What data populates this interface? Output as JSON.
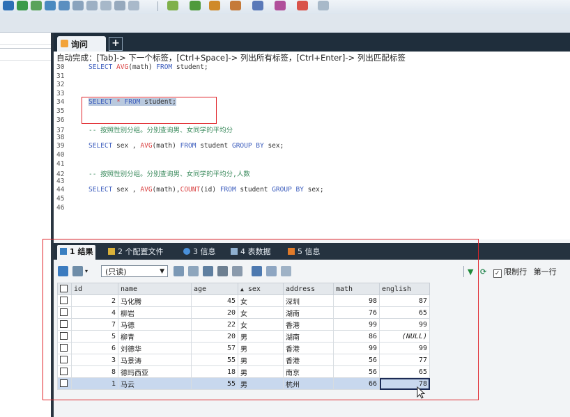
{
  "query_tab": {
    "label": "询问",
    "add": "+"
  },
  "editor": {
    "autocomplete_hint": "自动完成：[Tab]-> 下一个标签，[Ctrl+Space]-> 列出所有标签，[Ctrl+Enter]-> 列出匹配标签",
    "lines": [
      {
        "num": "30",
        "segments": [
          {
            "cls": "kw",
            "text": "SELECT "
          },
          {
            "cls": "fn",
            "text": "AVG"
          },
          {
            "cls": "",
            "text": "(math) "
          },
          {
            "cls": "kw",
            "text": "FROM"
          },
          {
            "cls": "",
            "text": " student;"
          }
        ]
      },
      {
        "num": "31",
        "segments": []
      },
      {
        "num": "32",
        "segments": []
      },
      {
        "num": "33",
        "segments": []
      },
      {
        "num": "34",
        "segments": [
          {
            "cls": "kw hl",
            "text": "SELECT"
          },
          {
            "cls": "hl",
            "text": " "
          },
          {
            "cls": "fn hl",
            "text": "*"
          },
          {
            "cls": "hl",
            "text": " "
          },
          {
            "cls": "kw hl",
            "text": "FROM"
          },
          {
            "cls": "hl",
            "text": " student;"
          }
        ]
      },
      {
        "num": "35",
        "segments": []
      },
      {
        "num": "36",
        "segments": []
      },
      {
        "num": "37",
        "segments": [
          {
            "cls": "cm",
            "text": "-- 按照性别分组。分别查询男、女同学的平均分"
          }
        ]
      },
      {
        "num": "38",
        "segments": []
      },
      {
        "num": "39",
        "segments": [
          {
            "cls": "kw",
            "text": "SELECT"
          },
          {
            "cls": "",
            "text": " sex , "
          },
          {
            "cls": "fn",
            "text": "AVG"
          },
          {
            "cls": "",
            "text": "(math) "
          },
          {
            "cls": "kw",
            "text": "FROM"
          },
          {
            "cls": "",
            "text": " student "
          },
          {
            "cls": "kw",
            "text": "GROUP BY"
          },
          {
            "cls": "",
            "text": " sex;"
          }
        ]
      },
      {
        "num": "40",
        "segments": []
      },
      {
        "num": "41",
        "segments": []
      },
      {
        "num": "42",
        "segments": [
          {
            "cls": "cm",
            "text": "-- 按照性别分组。分别查询男、女同学的平均分,人数"
          }
        ]
      },
      {
        "num": "43",
        "segments": []
      },
      {
        "num": "44",
        "segments": [
          {
            "cls": "kw",
            "text": "SELECT"
          },
          {
            "cls": "",
            "text": " sex , "
          },
          {
            "cls": "fn",
            "text": "AVG"
          },
          {
            "cls": "",
            "text": "(math),"
          },
          {
            "cls": "fn",
            "text": "COUNT"
          },
          {
            "cls": "",
            "text": "(id) "
          },
          {
            "cls": "kw",
            "text": "FROM"
          },
          {
            "cls": "",
            "text": " student "
          },
          {
            "cls": "kw",
            "text": "GROUP BY"
          },
          {
            "cls": "",
            "text": " sex;"
          }
        ]
      },
      {
        "num": "45",
        "segments": []
      },
      {
        "num": "46",
        "segments": []
      }
    ]
  },
  "results": {
    "tabs": [
      {
        "name": "result-tab-results",
        "label": "1 结果",
        "active": true,
        "icon_color": "#3a7fc1"
      },
      {
        "name": "result-tab-profiler",
        "label": "2 个配置文件",
        "active": false,
        "icon_color": "#d9b13a"
      },
      {
        "name": "result-tab-info",
        "label": "3 信息",
        "active": false,
        "icon_color": "#4a90d9"
      },
      {
        "name": "result-tab-table-data",
        "label": "4 表数据",
        "active": false,
        "icon_color": "#8fb0d0"
      },
      {
        "name": "result-tab-info2",
        "label": "5 信息",
        "active": false,
        "icon_color": "#e07b2a"
      }
    ],
    "readonly_select": "(只读)",
    "limit_label": "限制行",
    "first_row_label": "第一行",
    "columns": [
      "id",
      "name",
      "age",
      "sex",
      "address",
      "math",
      "english"
    ],
    "sort_indicator": "▲",
    "rows": [
      {
        "id": "2",
        "name": "马化腾",
        "age": "45",
        "sex": "女",
        "address": "深圳",
        "math": "98",
        "english": "87"
      },
      {
        "id": "4",
        "name": "柳岩",
        "age": "20",
        "sex": "女",
        "address": "湖南",
        "math": "76",
        "english": "65"
      },
      {
        "id": "7",
        "name": "马德",
        "age": "22",
        "sex": "女",
        "address": "香港",
        "math": "99",
        "english": "99"
      },
      {
        "id": "5",
        "name": "柳青",
        "age": "20",
        "sex": "男",
        "address": "湖南",
        "math": "86",
        "english": "(NULL)"
      },
      {
        "id": "6",
        "name": "刘德华",
        "age": "57",
        "sex": "男",
        "address": "香港",
        "math": "99",
        "english": "99"
      },
      {
        "id": "3",
        "name": "马景涛",
        "age": "55",
        "sex": "男",
        "address": "香港",
        "math": "56",
        "english": "77"
      },
      {
        "id": "8",
        "name": "德玛西亚",
        "age": "18",
        "sex": "男",
        "address": "南京",
        "math": "56",
        "english": "65"
      },
      {
        "id": "1",
        "name": "马云",
        "age": "55",
        "sex": "男",
        "address": "杭州",
        "math": "66",
        "english": "78"
      }
    ],
    "selected_row": 7
  }
}
